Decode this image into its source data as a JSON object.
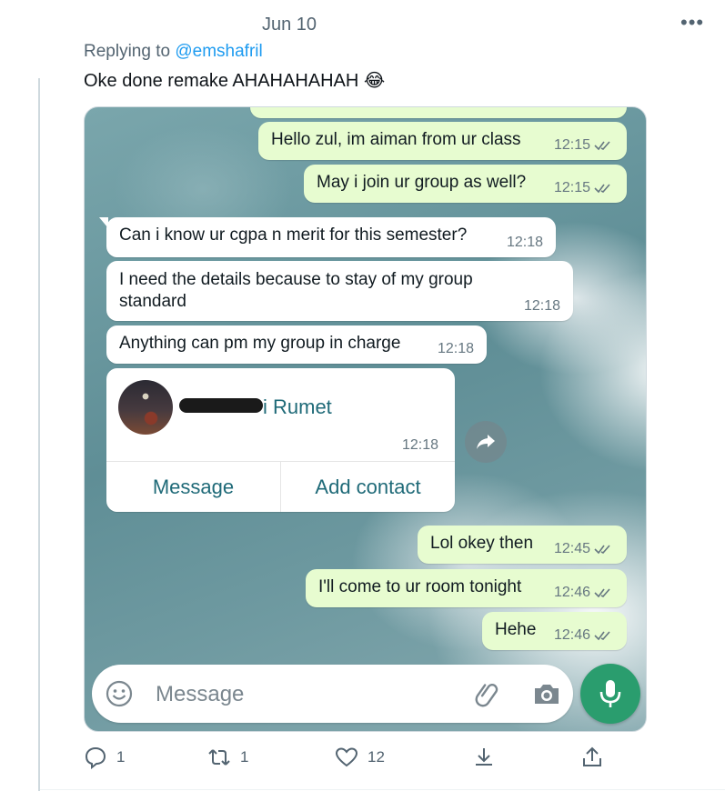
{
  "tweet": {
    "date": "Jun 10",
    "more_glyph": "•••",
    "replying_prefix": "Replying to",
    "replying_handle": "@emshafril",
    "text": "Oke done remake AHAHAHAHAH 😂"
  },
  "chat": {
    "messages": [
      {
        "direction": "out",
        "text": "Hello zul, im aiman from ur class",
        "time": "12:15",
        "read": true
      },
      {
        "direction": "out",
        "text": "May i join ur group as well?",
        "time": "12:15",
        "read": true
      },
      {
        "direction": "in",
        "text": "Can i know ur cgpa n merit for this semester?",
        "time": "12:18"
      },
      {
        "direction": "in",
        "text_line1": "I need the details because to stay of my group",
        "text_line2": "standard",
        "time": "12:18"
      },
      {
        "direction": "in",
        "text": "Anything can pm my group in charge",
        "time": "12:18"
      },
      {
        "direction": "out",
        "text": "Lol okey then",
        "time": "12:45",
        "read": true
      },
      {
        "direction": "out",
        "text": "I'll come to ur room tonight",
        "time": "12:46",
        "read": true
      },
      {
        "direction": "out",
        "text": "Hehe",
        "time": "12:46",
        "read": true
      }
    ],
    "contact_card": {
      "name_visible": "i Rumet",
      "time": "12:18",
      "message_button": "Message",
      "add_contact_button": "Add contact"
    },
    "input": {
      "placeholder": "Message"
    },
    "colors": {
      "outgoing_bubble": "#e7fcd0",
      "incoming_bubble": "#ffffff",
      "accent": "#1f6a78",
      "mic_button": "#2a9d6e"
    }
  },
  "tweet_actions": {
    "replies": "1",
    "retweets": "1",
    "likes": "12"
  },
  "icons": [
    "more-icon",
    "double-check-icon",
    "forward-icon",
    "emoji-icon",
    "attach-icon",
    "camera-icon",
    "mic-icon",
    "reply-icon",
    "retweet-icon",
    "like-icon",
    "download-icon",
    "share-icon"
  ]
}
